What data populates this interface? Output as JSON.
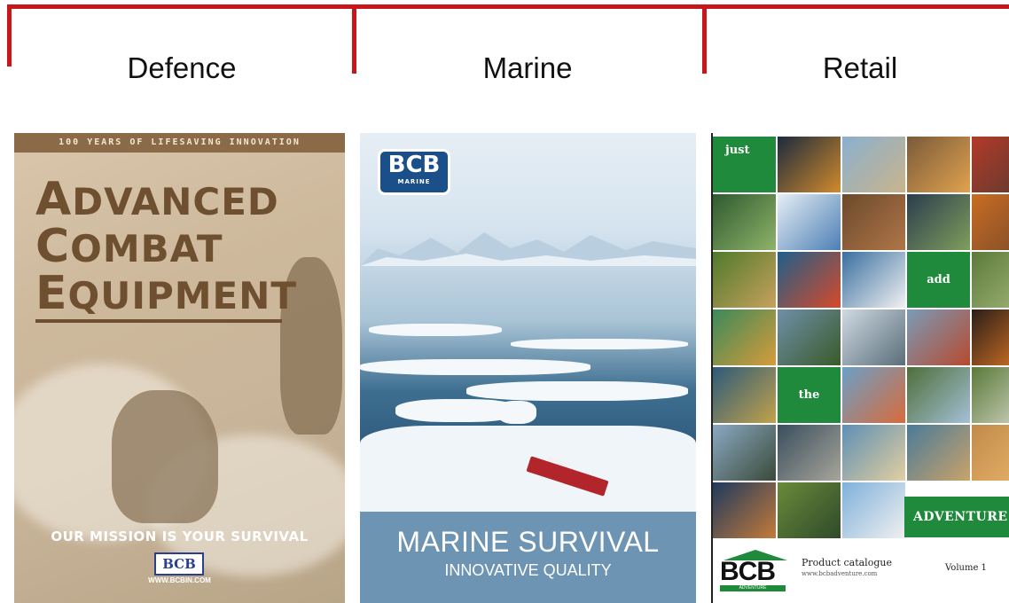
{
  "headings": [
    "Defence",
    "Marine",
    "Retail"
  ],
  "colors": {
    "bracket": "#c8161d",
    "defence_brown": "#6e4f2f",
    "marine_band": "#6d94b3",
    "retail_green": "#1f8a3b"
  },
  "defence": {
    "strip": "100 YEARS OF LIFESAVING INNOVATION",
    "line1_cap": "A",
    "line1_rest": "DVANCED",
    "line2_cap": "C",
    "line2_rest": "OMBAT",
    "line3_cap": "E",
    "line3_rest": "QUIPMENT",
    "mission": "OUR MISSION IS YOUR SURVIVAL",
    "logo": "BCB",
    "url": "WWW.BCBIN.COM"
  },
  "marine": {
    "logo": "BCB",
    "logo_sub": "MARINE",
    "title": "MARINE SURVIVAL",
    "subtitle": "INNOVATIVE QUALITY"
  },
  "retail": {
    "word_just": "just",
    "word_add": "add",
    "word_the": "the",
    "word_adventure": "ADVENTURE",
    "logo": "BCB",
    "logo_sub": "ADVENTURE",
    "catalogue": "Product catalogue",
    "url": "www.bcbadventure.com",
    "volume": "Volume 1"
  }
}
